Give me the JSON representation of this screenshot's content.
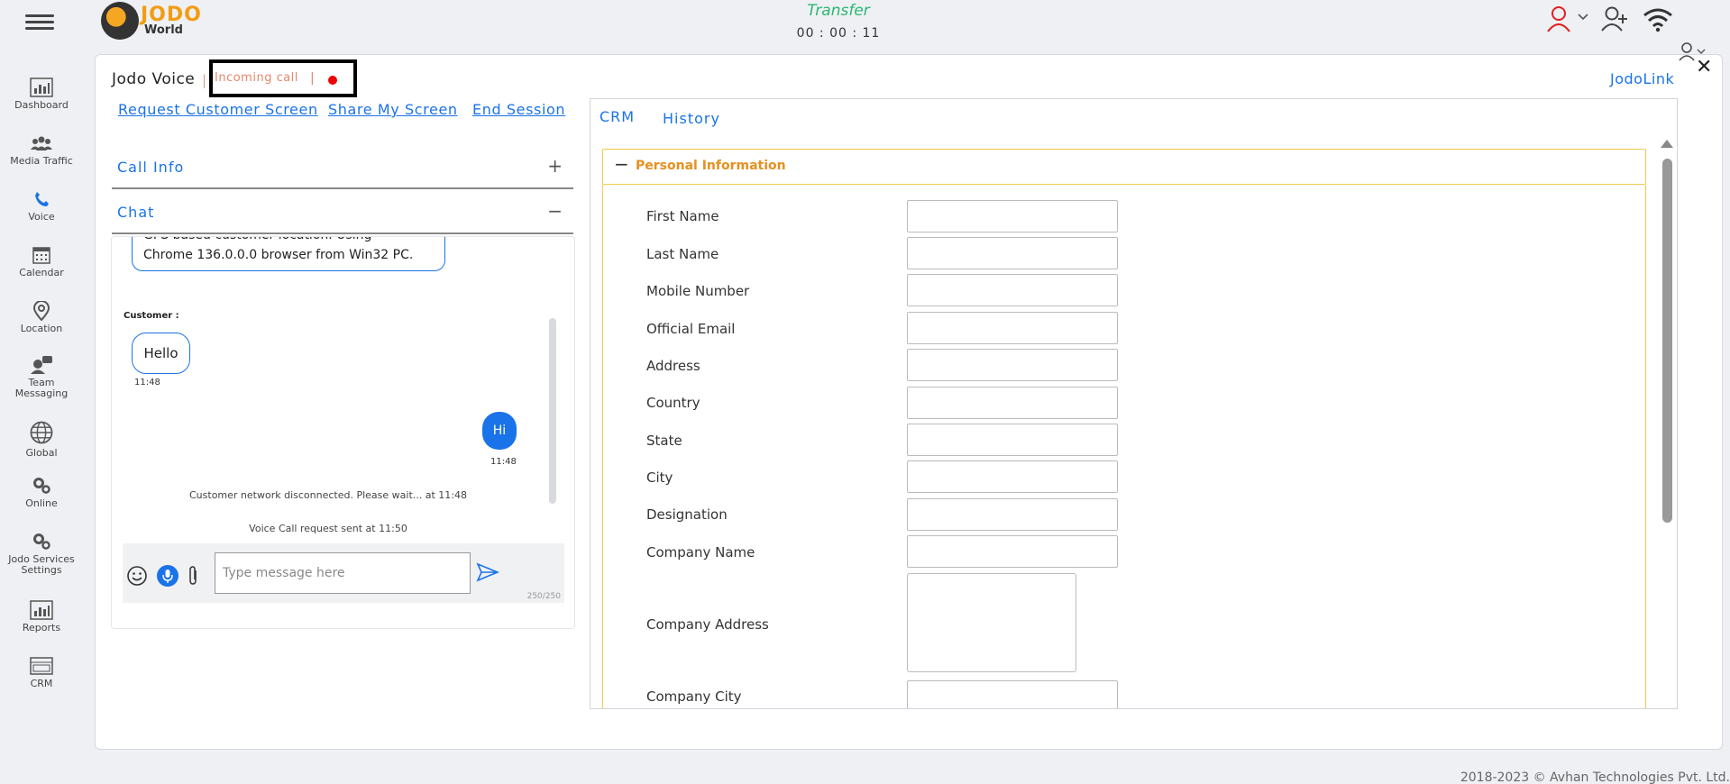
{
  "header": {
    "logo_line1": "JODO",
    "logo_line2": "World",
    "status": "Transfer",
    "timer": "00 : 00 : 11"
  },
  "sidebar": {
    "items": [
      {
        "label": "Dashboard",
        "icon": "dashboard-icon"
      },
      {
        "label": "Media Traffic",
        "icon": "media-traffic-icon"
      },
      {
        "label": "Voice",
        "icon": "phone-icon"
      },
      {
        "label": "Calendar",
        "icon": "calendar-icon"
      },
      {
        "label": "Location",
        "icon": "location-pin-icon"
      },
      {
        "label": "Team Messaging",
        "icon": "team-messaging-icon"
      },
      {
        "label": "Global",
        "icon": "globe-icon"
      },
      {
        "label": "Online",
        "icon": "gears-icon"
      },
      {
        "label": "Jodo Services Settings",
        "icon": "gears-icon"
      },
      {
        "label": "Reports",
        "icon": "reports-icon"
      },
      {
        "label": "CRM",
        "icon": "crm-icon"
      }
    ]
  },
  "session": {
    "title": "Jodo Voice",
    "separator": "|",
    "incoming": "Incoming call",
    "incoming_sep": "|",
    "jodolink": "JodoLink"
  },
  "actions": {
    "request_screen": "Request Customer Screen",
    "share_screen": "Share My Screen",
    "end_session": "End Session"
  },
  "accordion": {
    "call_info": "Call Info",
    "call_info_sign": "+",
    "chat": "Chat",
    "chat_sign": "−"
  },
  "chat": {
    "top_message_line1": "GPS based customer location. Using",
    "top_message_line2": "Chrome 136.0.0.0 browser from Win32 PC.",
    "customer_label": "Customer :",
    "customer_message": "Hello",
    "customer_time": "11:48",
    "agent_message": "Hi",
    "agent_time": "11:48",
    "system_1": "Customer network disconnected. Please wait... at 11:48",
    "system_2": "Voice Call request sent at 11:50",
    "input_placeholder": "Type message here",
    "counter": "250/250"
  },
  "crm": {
    "tabs": [
      "CRM",
      "History"
    ],
    "section_sign": "−",
    "section_title": "Personal Information",
    "fields": [
      "First Name",
      "Last Name",
      "Mobile Number",
      "Official Email",
      "Address",
      "Country",
      "State",
      "City",
      "Designation",
      "Company Name",
      "Company Address",
      "Company City"
    ]
  },
  "footer": {
    "text": "2018-2023 © Avhan Technologies Pvt. Ltd."
  },
  "colors": {
    "accent": "#1a73e8",
    "section": "#e69020",
    "transfer": "#2bb673",
    "incoming": "#e8866b"
  }
}
